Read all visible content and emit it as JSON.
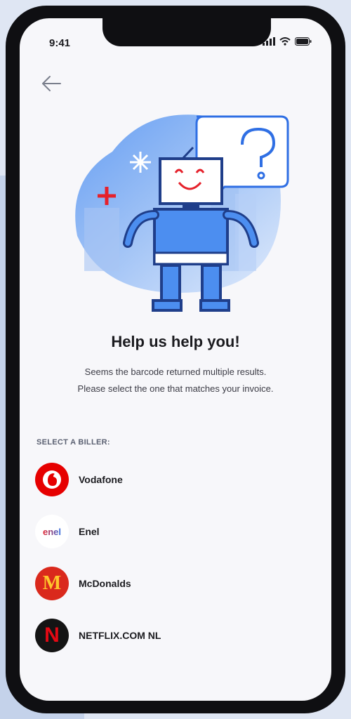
{
  "status_bar": {
    "time": "9:41"
  },
  "header": {
    "back_icon": "arrow-left-icon"
  },
  "illustration": {
    "icon": "robot-question-illustration",
    "accent": "#2f6fe4",
    "plus_color": "#e5212b"
  },
  "main": {
    "title": "Help us help you!",
    "desc_line1": "Seems the barcode returned multiple results.",
    "desc_line2": "Please select the one that matches your invoice.",
    "section_label": "SELECT A BILLER:"
  },
  "billers": [
    {
      "name": "Vodafone",
      "icon": "vodafone-logo",
      "color": "#e60000"
    },
    {
      "name": "Enel",
      "icon": "enel-logo",
      "color": "#ffffff"
    },
    {
      "name": "McDonalds",
      "icon": "mcdonalds-logo",
      "color": "#da291c"
    },
    {
      "name": "NETFLIX.COM NL",
      "icon": "netflix-logo",
      "color": "#141414"
    }
  ],
  "logos": {
    "enel_text": "enel",
    "netflix_letter": "N",
    "mcd_letter": "M"
  }
}
